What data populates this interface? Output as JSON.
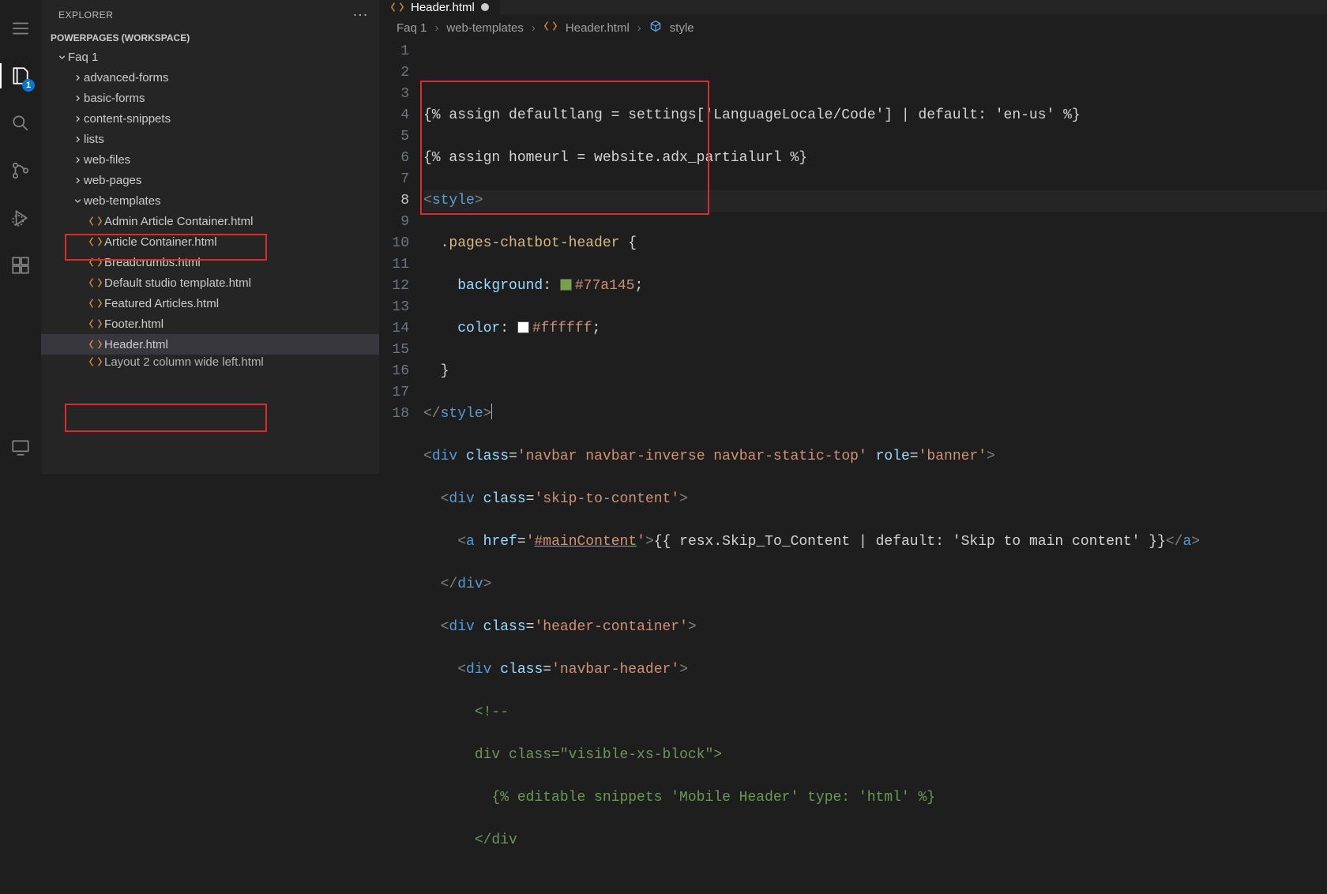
{
  "activity": {
    "explorer_badge": "1"
  },
  "sidebar": {
    "title": "EXPLORER",
    "workspace_title": "POWERPAGES (WORKSPACE)",
    "tree": {
      "root": {
        "label": "Faq 1",
        "expanded": true
      },
      "folders": [
        {
          "label": "advanced-forms"
        },
        {
          "label": "basic-forms"
        },
        {
          "label": "content-snippets"
        },
        {
          "label": "lists"
        },
        {
          "label": "web-files"
        },
        {
          "label": "web-pages"
        }
      ],
      "web_templates": {
        "label": "web-templates",
        "expanded": true
      },
      "files": [
        "Admin Article Container.html",
        "Article Container.html",
        "Breadcrumbs.html",
        "Default studio template.html",
        "Featured Articles.html",
        "Footer.html",
        "Header.html",
        "Layout 2 column wide left.html"
      ]
    }
  },
  "tab": {
    "filename": "Header.html",
    "dirty": true
  },
  "breadcrumbs": {
    "p0": "Faq 1",
    "p1": "web-templates",
    "p2": "Header.html",
    "p3": "style"
  },
  "code": {
    "active_line": 8,
    "line1": "{% assign defaultlang = settings['LanguageLocale/Code'] | default: 'en-us' %}",
    "line2": "{% assign homeurl = website.adx_partialurl %}",
    "line3_tag": "style",
    "line4_selector": ".pages-chatbot-header",
    "line5_prop": "background",
    "line5_val": "#77a145",
    "line6_prop": "color",
    "line6_val": "#ffffff",
    "line9_attr_class": "navbar navbar-inverse navbar-static-top",
    "line9_attr_role": "banner",
    "line10_class": "skip-to-content",
    "line11_href": "#mainContent",
    "line11_expr": "{{ resx.Skip_To_Content | default: 'Skip to main content' }}",
    "line13_class": "header-container",
    "line14_class": "navbar-header",
    "line16_class": "visible-xs-block",
    "line17_expr": "{% editable snippets 'Mobile Header' type: 'html' %}"
  },
  "icons": {
    "menu": "menu-icon",
    "files": "files-icon",
    "search": "search-icon",
    "scm": "source-control-icon",
    "debug": "run-debug-icon",
    "extensions": "extensions-icon",
    "remote": "remote-icon"
  }
}
